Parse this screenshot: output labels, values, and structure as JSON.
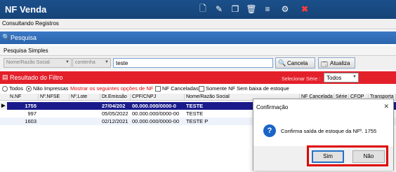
{
  "app": {
    "title": "NF Venda"
  },
  "toolbar": {
    "icons": [
      "new-document-icon",
      "edit-icon",
      "copy-icon",
      "delete-icon",
      "menu-icon",
      "settings-icon",
      "close-icon"
    ]
  },
  "subtab": {
    "label": "Consultando Registros"
  },
  "panel": {
    "title": "Pesquisa"
  },
  "search_tab": {
    "label": "Pesquisa Simples"
  },
  "search": {
    "field_select": "Nome/Razão Social",
    "operator_select": "contenha",
    "value": "teste",
    "cancel_label": "Cancela",
    "update_label": "Atualiza"
  },
  "filter": {
    "title": "Resultado do Filtro",
    "series_label": "Selecionar Série :",
    "series_value": "Todos"
  },
  "options": {
    "todos": "Todos",
    "nao_impressas": "Não Impressas",
    "show_label": "Mostrar os seguintes opções de NF :",
    "nf_canceladas": "NF Canceladas",
    "somente_sem_baixa": "Somente NF Sem baixa de estoque"
  },
  "grid": {
    "columns": [
      "N.NF",
      "Nº.NFSE",
      "Nº.Lote",
      "Dt.Emissão",
      "CPF/CNPJ",
      "Nome/Razão Social",
      "NF Cancelada",
      "Série",
      "CFOP",
      "Transporta"
    ],
    "rows": [
      {
        "nf": "1755",
        "nfse": "",
        "lote": "",
        "emissao": "27/04/202",
        "cnpj": "00.000.000/0000-0",
        "nome": "TESTE"
      },
      {
        "nf": "997",
        "nfse": "",
        "lote": "",
        "emissao": "05/05/2022",
        "cnpj": "00.000.000/0000-00",
        "nome": "TESTE"
      },
      {
        "nf": "1603",
        "nfse": "",
        "lote": "",
        "emissao": "02/12/2021",
        "cnpj": "00.000.000/0000-00",
        "nome": "TESTE P"
      }
    ]
  },
  "dialog": {
    "title": "Confirmação",
    "message": "Confirma saída de estoque da NFº. 1755",
    "yes_label": "Sim",
    "no_label": "Não"
  },
  "colors": {
    "titlebar": "#164478",
    "filter_bar": "#e3202a",
    "selected_row": "#1a1a8c",
    "highlight_box": "#e00000"
  }
}
